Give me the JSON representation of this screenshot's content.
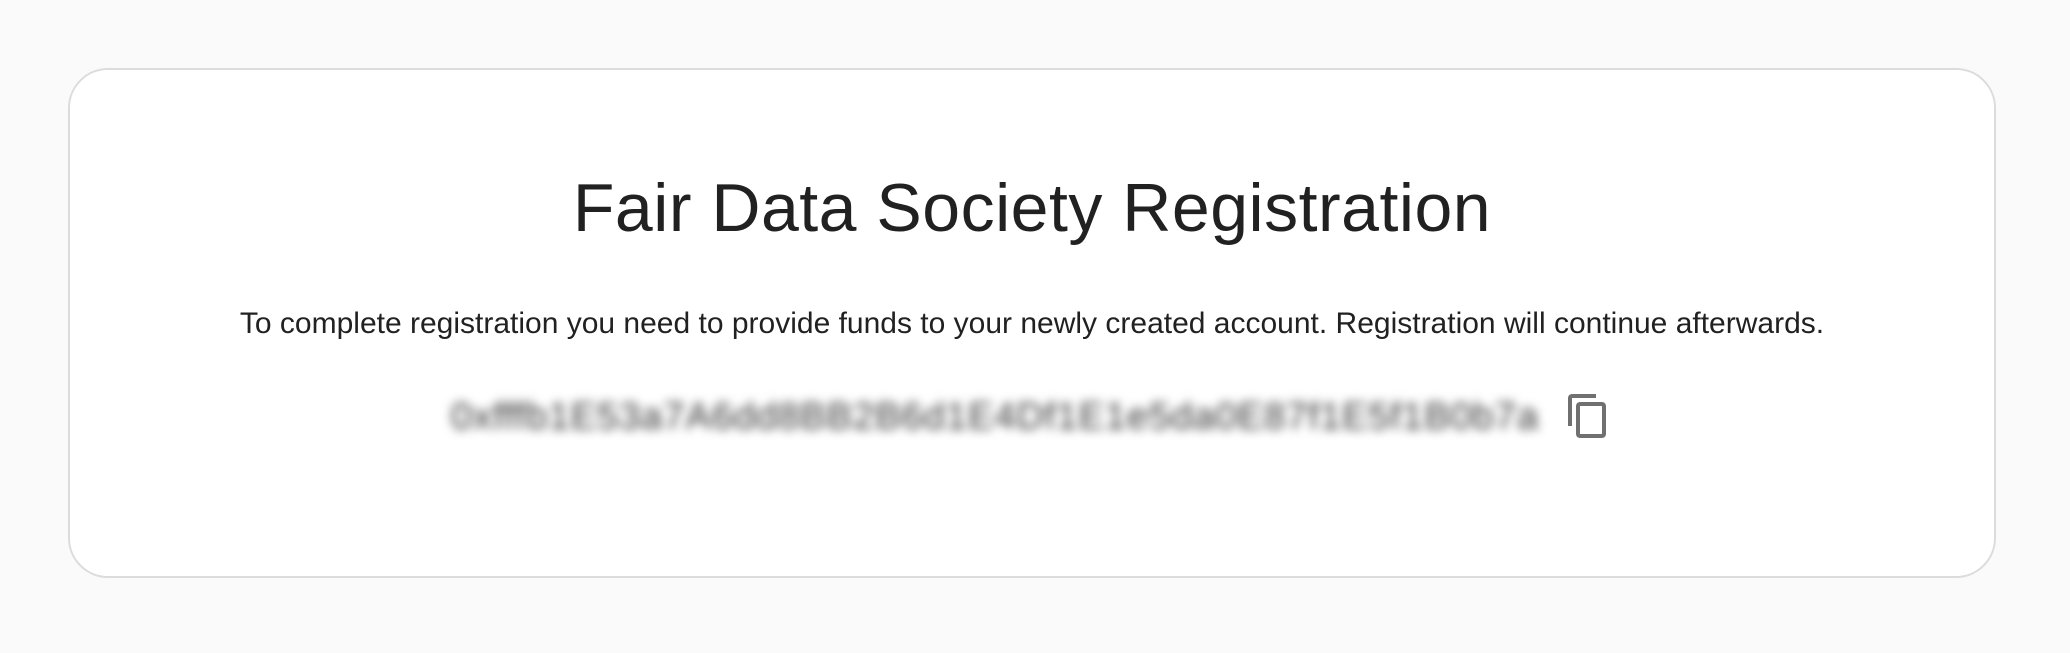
{
  "registration": {
    "title": "Fair Data Society Registration",
    "description": "To complete registration you need to provide funds to your newly created account. Registration will continue afterwards.",
    "address": "0xfffb1E53a7A6dd8BB2B6d1E4Df1E1e5da0E87f1E5f1B0b7a",
    "address_obscured": true,
    "copy_icon": "copy-icon"
  },
  "colors": {
    "background": "#fafafa",
    "card": "#ffffff",
    "card_border": "#dcdcdc",
    "text": "#212121",
    "icon": "#707070"
  }
}
